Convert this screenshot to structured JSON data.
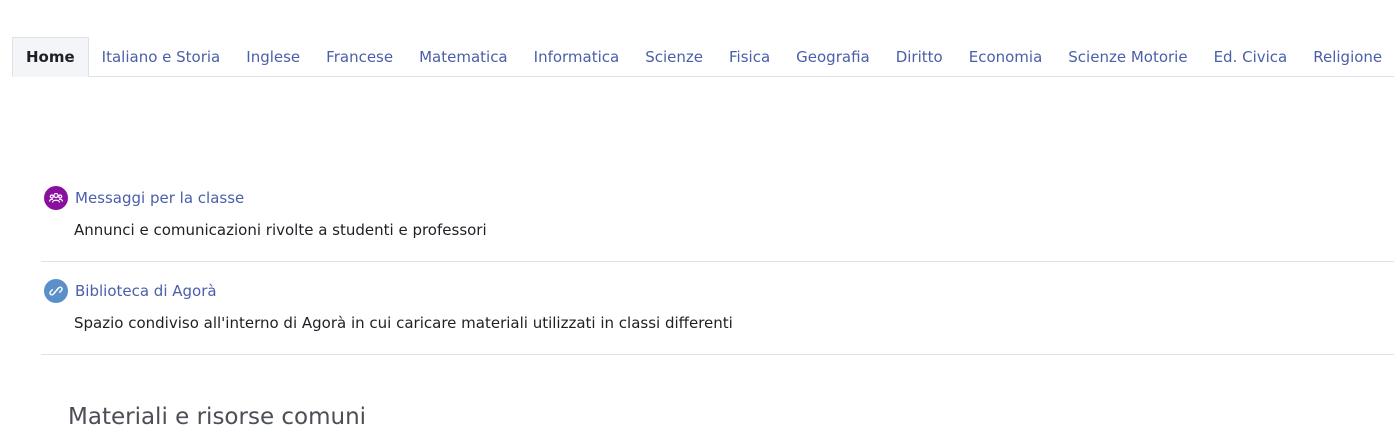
{
  "tabs": [
    {
      "label": "Home",
      "active": true
    },
    {
      "label": "Italiano e Storia"
    },
    {
      "label": "Inglese"
    },
    {
      "label": "Francese"
    },
    {
      "label": "Matematica"
    },
    {
      "label": "Informatica"
    },
    {
      "label": "Scienze"
    },
    {
      "label": "Fisica"
    },
    {
      "label": "Geografia"
    },
    {
      "label": "Diritto"
    },
    {
      "label": "Economia"
    },
    {
      "label": "Scienze Motorie"
    },
    {
      "label": "Ed. Civica"
    },
    {
      "label": "Religione"
    }
  ],
  "activities": [
    {
      "icon": "forum-icon",
      "icon_color": "#8a0f9e",
      "title": "Messaggi per la classe",
      "description": "Annunci e comunicazioni rivolte a studenti e professori"
    },
    {
      "icon": "link-icon",
      "icon_color": "#5b8fc9",
      "title": "Biblioteca di Agorà",
      "description": "Spazio condiviso all'interno di Agorà in cui caricare materiali utilizzati in classi differenti"
    }
  ],
  "section": {
    "title": "Materiali e risorse comuni"
  },
  "colors": {
    "link": "#4a5faa",
    "text": "#1d2125",
    "border": "#dee2e6"
  }
}
